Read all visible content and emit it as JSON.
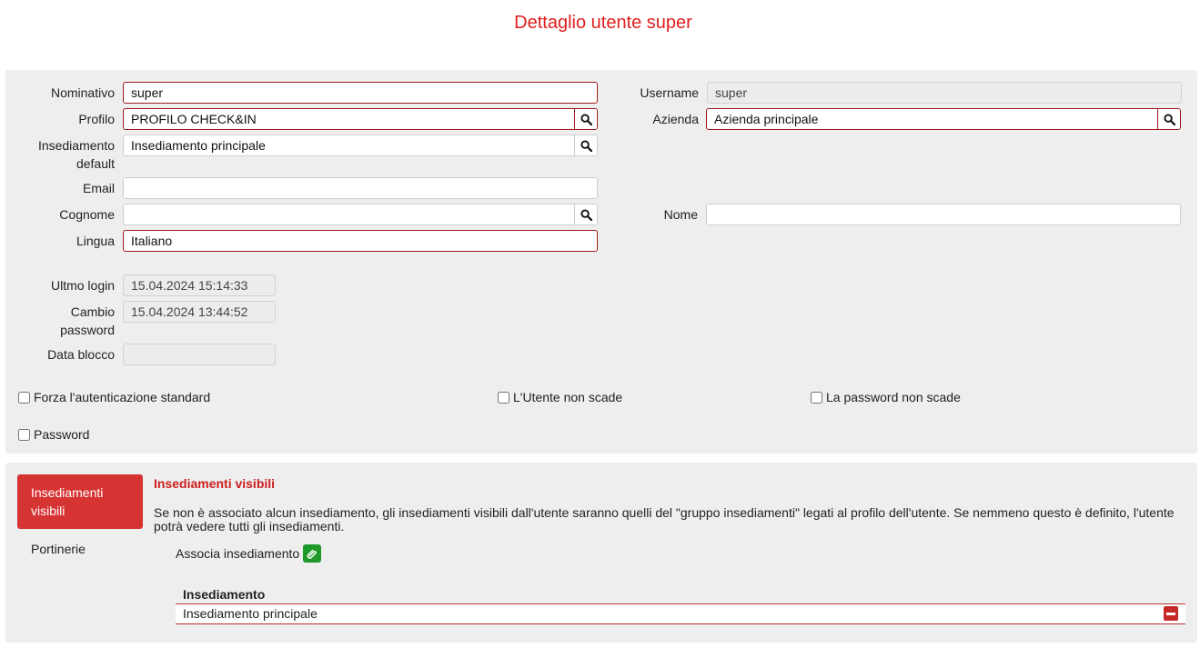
{
  "page": {
    "title": "Dettaglio utente super"
  },
  "form": {
    "nominativo": {
      "label": "Nominativo",
      "value": "super"
    },
    "username": {
      "label": "Username",
      "value": "super"
    },
    "profilo": {
      "label": "Profilo",
      "value": "PROFILO CHECK&IN"
    },
    "azienda": {
      "label": "Azienda",
      "value": "Azienda principale"
    },
    "insediamento_default": {
      "label_line1": "Insediamento",
      "label_line2": "default",
      "value": "Insediamento principale"
    },
    "email": {
      "label": "Email",
      "value": ""
    },
    "cognome": {
      "label": "Cognome",
      "value": ""
    },
    "nome": {
      "label": "Nome",
      "value": ""
    },
    "lingua": {
      "label": "Lingua",
      "value": "Italiano"
    },
    "ultimo_login": {
      "label": "Ultmo login",
      "value": "15.04.2024 15:14:33"
    },
    "cambio_password": {
      "label_line1": "Cambio",
      "label_line2": "password",
      "value": "15.04.2024 13:44:52"
    },
    "data_blocco": {
      "label": "Data blocco",
      "value": ""
    }
  },
  "checkboxes": {
    "forza_auth": {
      "label": "Forza l'autenticazione standard",
      "checked": false
    },
    "utente_non_scade": {
      "label": "L'Utente non scade",
      "checked": false
    },
    "password_non_scade": {
      "label": "La password non scade",
      "checked": false
    },
    "password": {
      "label": "Password",
      "checked": false
    }
  },
  "tabs": [
    {
      "label_line1": "Insediamenti",
      "label_line2": "visibili",
      "active": true
    },
    {
      "label": "Portinerie",
      "active": false
    }
  ],
  "section": {
    "title": "Insediamenti visibili",
    "description": "Se non è associato alcun insediamento, gli insediamenti visibili dall'utente saranno quelli del \"gruppo insediamenti\" legati al profilo dell'utente. Se nemmeno questo è definito, l'utente potrà vedere tutti gli insediamenti.",
    "associate_label": "Associa insediamento"
  },
  "table": {
    "header": "Insediamento",
    "rows": [
      "Insediamento principale"
    ]
  },
  "icons": {
    "lookup": "search-icon",
    "associate": "paperclip-icon",
    "remove": "minus-icon"
  },
  "colors": {
    "accent": "#d63333",
    "title": "#e01e1e",
    "success": "#1e9a2a"
  }
}
